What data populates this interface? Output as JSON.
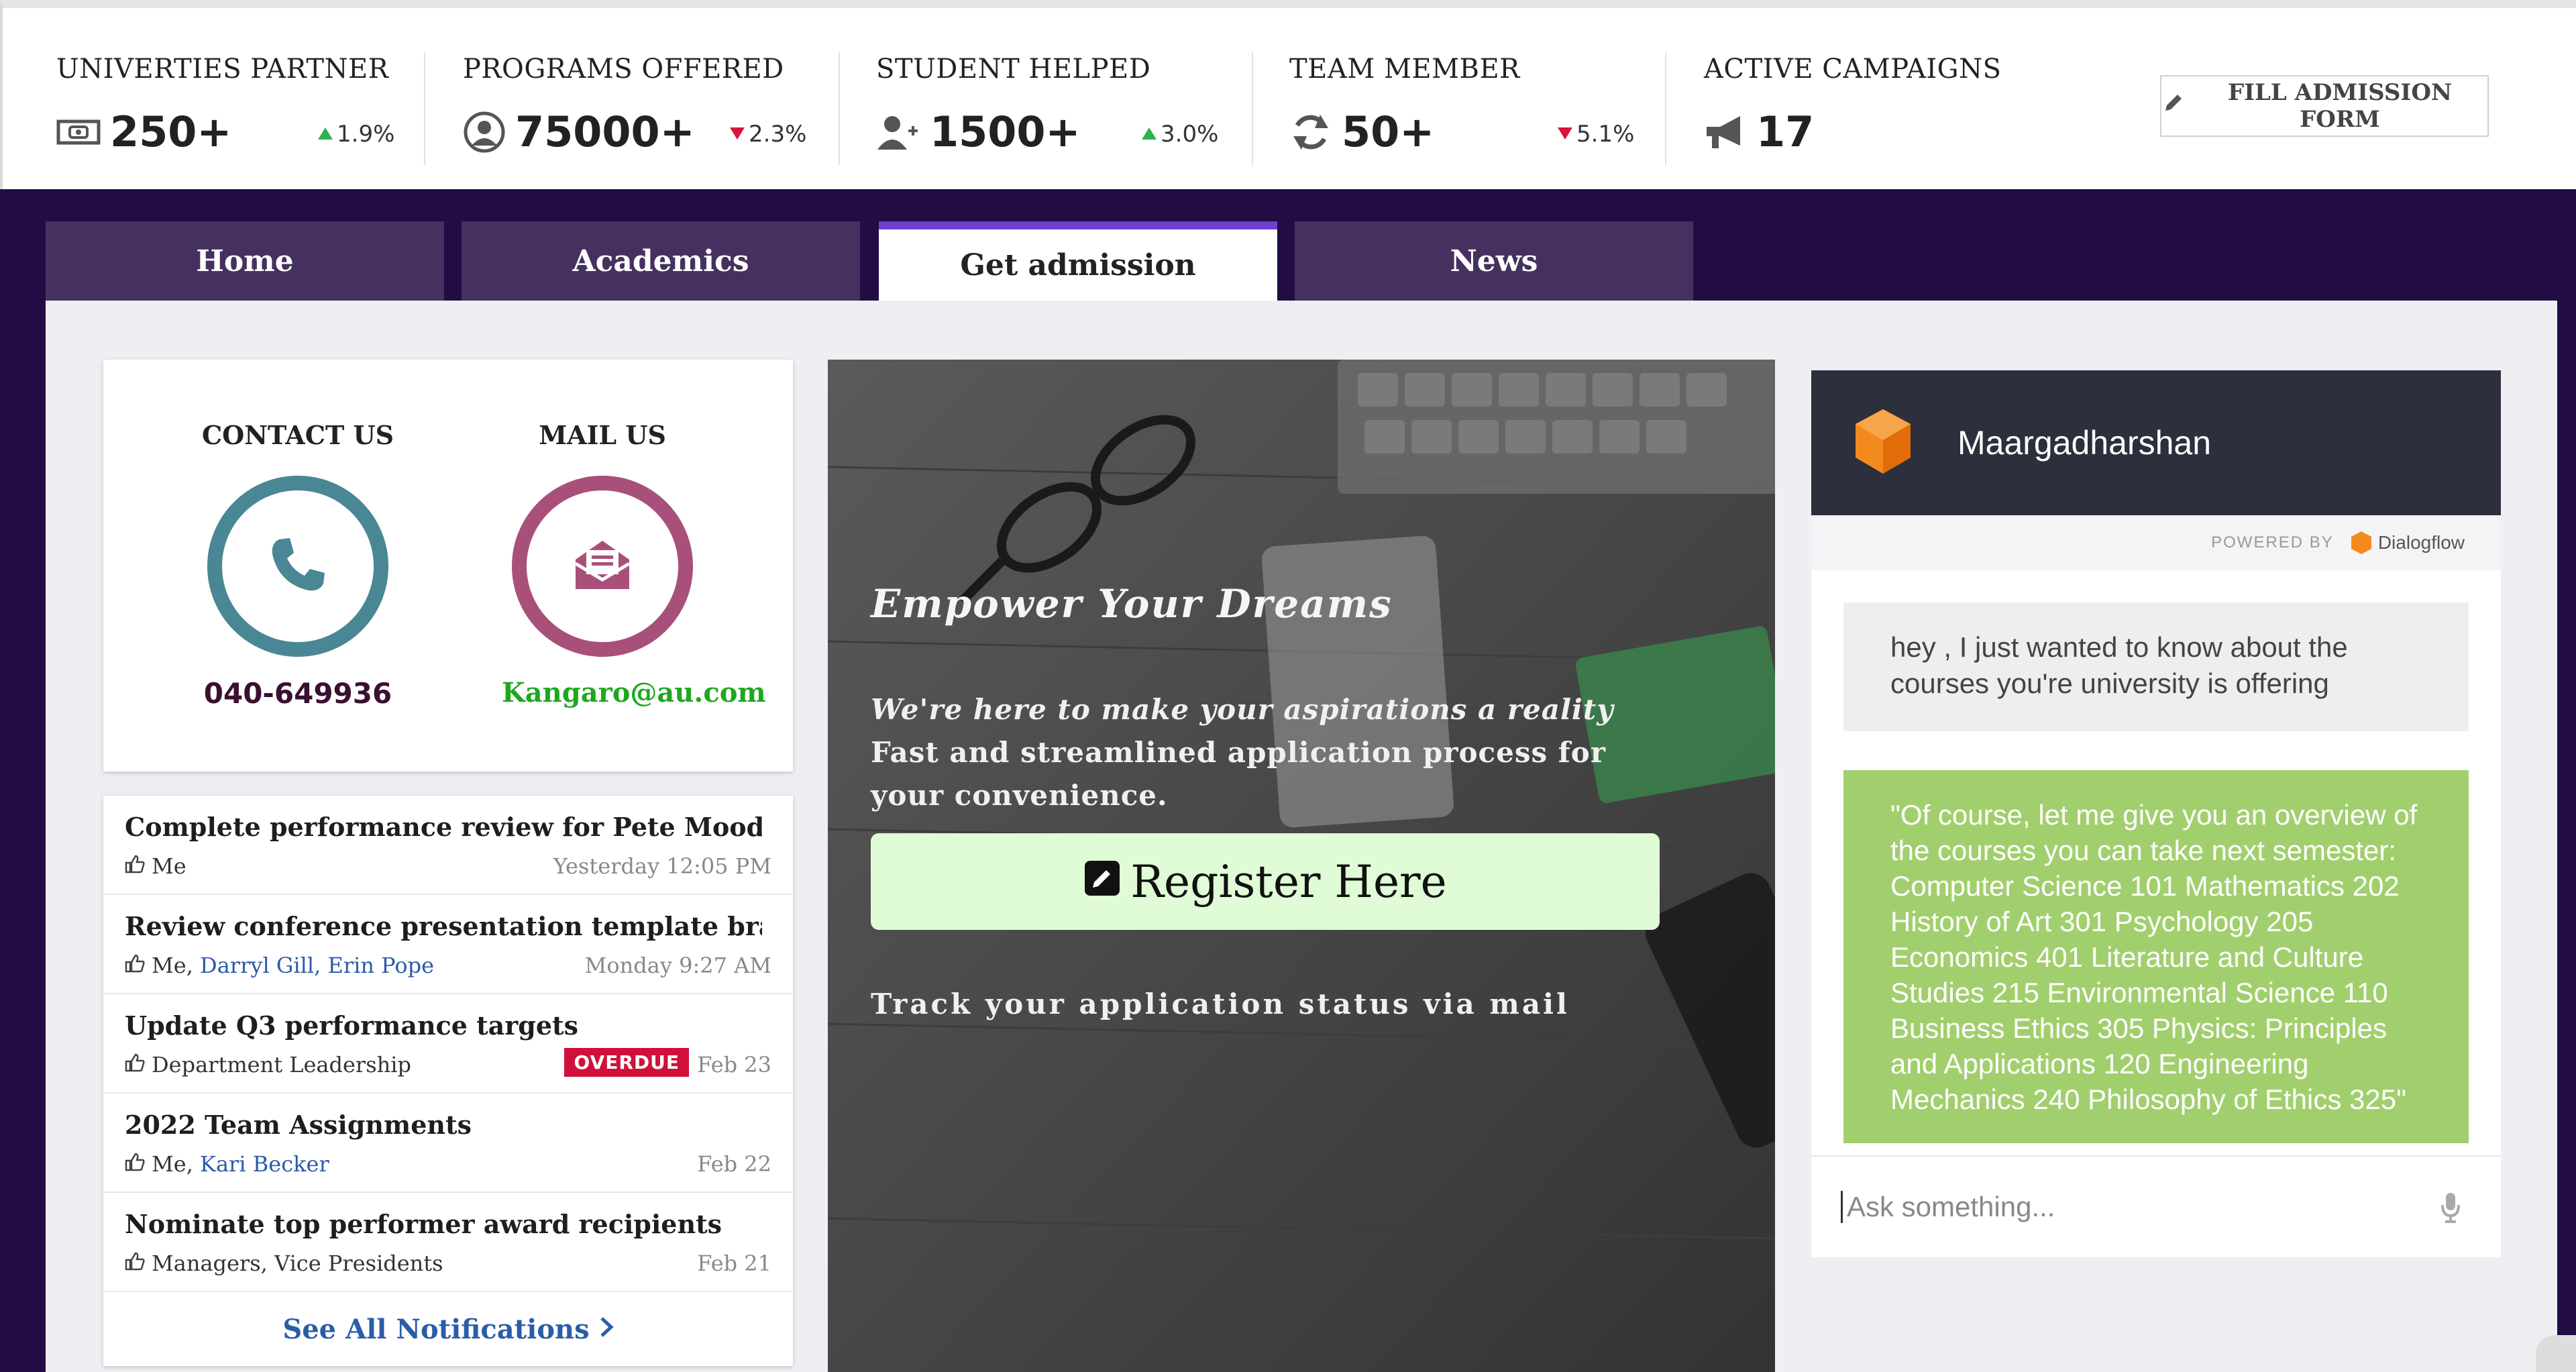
{
  "stats": [
    {
      "label": "UNIVERTIES PARTNER",
      "value": "250+",
      "trend": "1.9%",
      "direction": "up",
      "icon": "money-icon"
    },
    {
      "label": "PROGRAMS OFFERED",
      "value": "75000+",
      "trend": "2.3%",
      "direction": "down",
      "icon": "user-circle-icon"
    },
    {
      "label": "STUDENT HELPED",
      "value": "1500+",
      "trend": "3.0%",
      "direction": "up",
      "icon": "user-plus-icon"
    },
    {
      "label": "TEAM MEMBER",
      "value": "50+",
      "trend": "5.1%",
      "direction": "down",
      "icon": "refresh-icon"
    },
    {
      "label": "ACTIVE CAMPAIGNS",
      "value": "17",
      "icon": "megaphone-icon"
    }
  ],
  "fill_button": "FILL ADMISSION FORM",
  "tabs": [
    "Home",
    "Academics",
    "Get admission",
    "News"
  ],
  "active_tab": "Get admission",
  "contact": {
    "contact_title": "CONTACT US",
    "phone": "040-649936",
    "mail_title": "MAIL US",
    "email": "Kangaro@au.com"
  },
  "notifications": {
    "items": [
      {
        "title": "Complete performance review for Pete Moody",
        "who": "Me",
        "links": "",
        "date": "Yesterday 12:05 PM"
      },
      {
        "title": "Review conference presentation template branding ...",
        "who": "Me, ",
        "links": "Darryl Gill, Erin Pope",
        "date": "Monday 9:27 AM"
      },
      {
        "title": "Update Q3 performance targets",
        "who": "Department Leadership",
        "links": "",
        "date": "Feb 23",
        "badge": "OVERDUE"
      },
      {
        "title": "2022 Team Assignments",
        "who": "Me, ",
        "links": "Kari Becker",
        "date": "Feb 22"
      },
      {
        "title": "Nominate top performer award recipients",
        "who": "Managers, Vice Presidents",
        "links": "",
        "date": "Feb 21"
      }
    ],
    "see_all": "See All Notifications"
  },
  "hero": {
    "title": "Empower Your Dreams",
    "line1": "We're here to make your aspirations a reality",
    "line2": "Fast and streamlined application process for your convenience.",
    "register": "Register Here",
    "track": "Track your application status via mail"
  },
  "chat": {
    "bot_name": "Maargadharshan",
    "powered_by": "POWERED BY",
    "provider": "Dialogflow",
    "user_message": "hey , I just wanted to know about the courses you're university is offering",
    "bot_message": "\"Of course, let me give you an overview of the courses you can take next semester: Computer Science 101 Mathematics 202 History of Art 301 Psychology 205 Economics 401 Literature and Culture Studies 215 Environmental Science 110 Business Ethics 305 Physics: Principles and Applications 120 Engineering Mechanics 240 Philosophy of Ethics 325\"",
    "input_placeholder": "Ask something..."
  },
  "colors": {
    "band": "#230c44",
    "tab": "#45305f",
    "tab_active_accent": "#6f3fd0",
    "phone_ring": "#4a8794",
    "mail_ring": "#a8507a",
    "email_text": "#1fa81f",
    "phone_text": "#3a1030",
    "bot_bubble": "#a2cf6e",
    "register_bg": "#e0fcd7",
    "overdue": "#d0103a",
    "trend_up": "#2db34a",
    "trend_down": "#d6163c"
  }
}
